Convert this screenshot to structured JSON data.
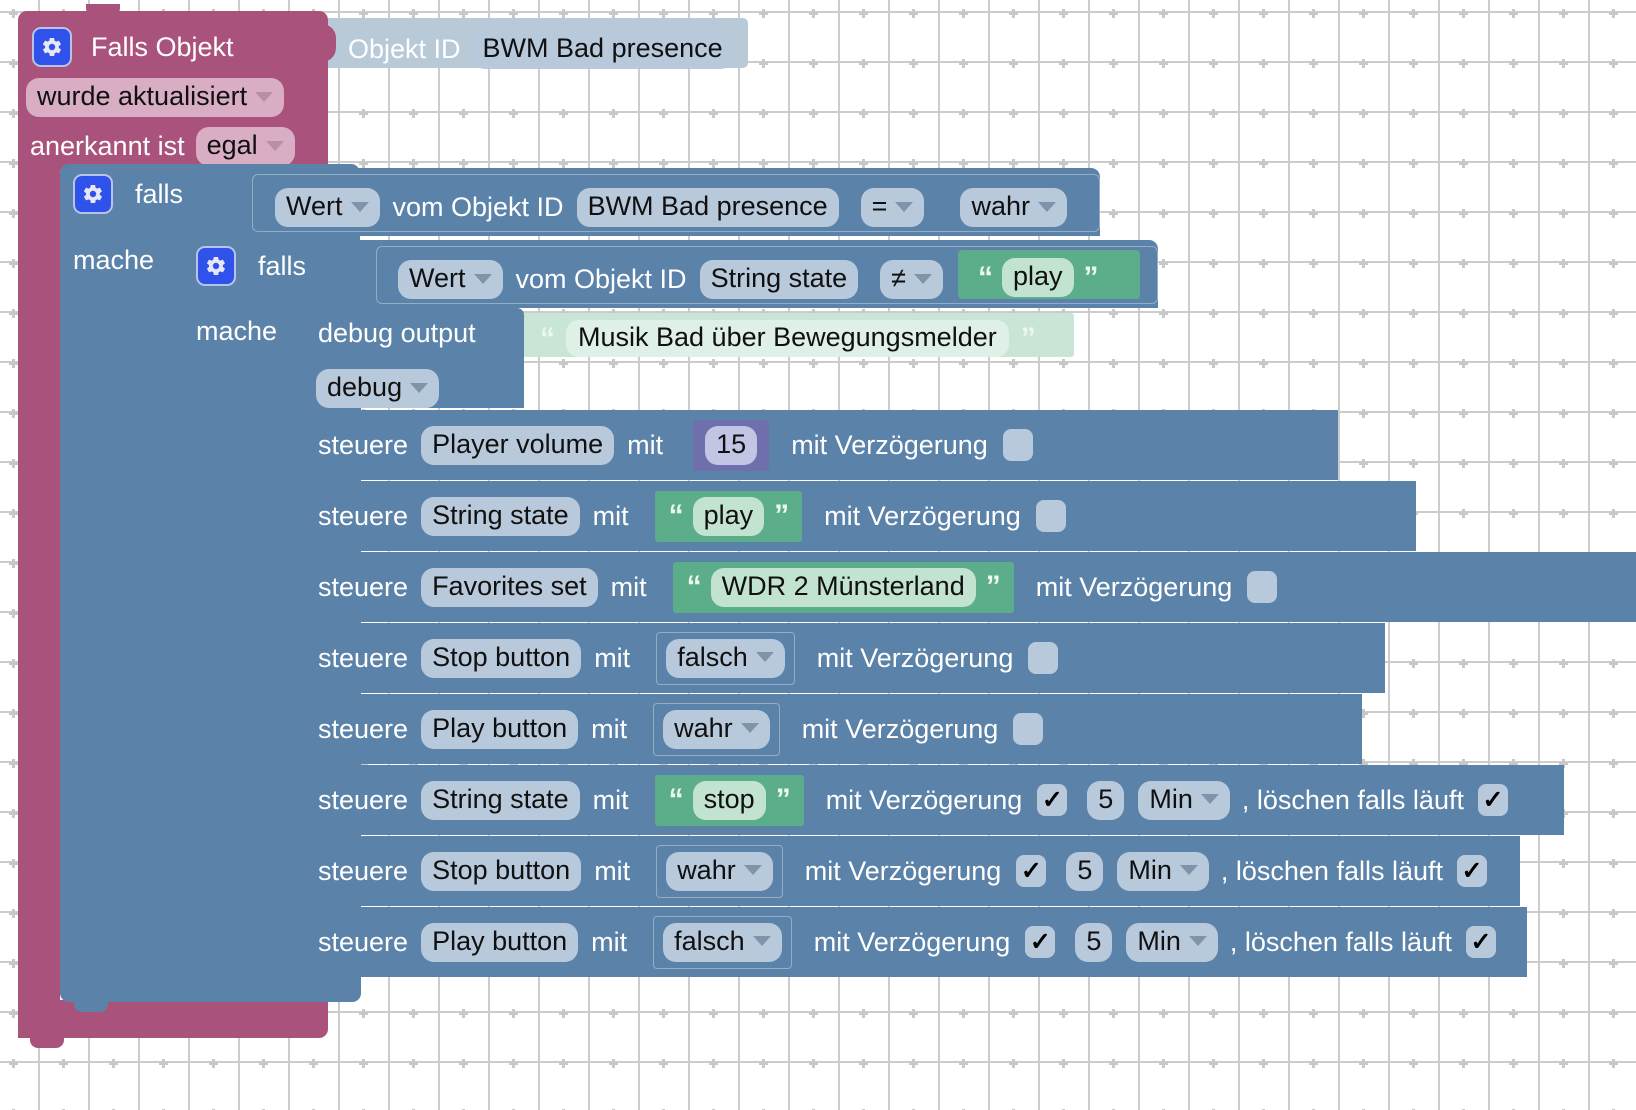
{
  "app": {
    "kind": "blockly-visual-script",
    "language": "de",
    "background": "#ffffff",
    "grid_color": "#c8c8c8",
    "grid_spacing": 50
  },
  "colors": {
    "trigger_block": "#a9537c",
    "trigger_field": "#d9aec4",
    "logic_block": "#5b82a8",
    "logic_field": "#b9c9dc",
    "object_block": "#b8c9d8",
    "string_block": "#5cae8a",
    "string_field": "#c3e3d1",
    "debug_string_block": "#c9e5d5",
    "debug_string_field": "#dff0e6",
    "number_block": "#6f6fae",
    "number_field": "#c2c6e4",
    "gear_icon": "#2f52ea"
  },
  "trigger": {
    "gear_icon": "gear-icon",
    "title": "Falls Objekt",
    "mode": "wurde aktualisiert",
    "ack_label": "anerkannt ist",
    "ack_value": "egal",
    "object": {
      "label": "Objekt ID",
      "value": "BWM Bad presence"
    }
  },
  "if_outer": {
    "gear_icon": "gear-icon",
    "keyword": "falls",
    "do_keyword": "mache",
    "condition": {
      "getter_mode": "Wert",
      "getter_label": "vom Objekt ID",
      "object_id": "BWM Bad presence",
      "operator": "=",
      "compare_value": "wahr"
    }
  },
  "if_inner": {
    "gear_icon": "gear-icon",
    "keyword": "falls",
    "do_keyword": "mache",
    "condition": {
      "getter_mode": "Wert",
      "getter_label": "vom Objekt ID",
      "object_id": "String state",
      "operator": "≠",
      "compare_value": "play"
    }
  },
  "debug": {
    "label": "debug output",
    "message": "Musik Bad über Bewegungsmelder",
    "level": "debug",
    "quote_open": "“",
    "quote_close": "”"
  },
  "control_rows": [
    {
      "keyword": "steuere",
      "target": "Player volume",
      "with_label": "mit",
      "value": "15",
      "value_type": "number",
      "delay_label": "mit Verzögerung",
      "delay_checked": false,
      "delay_amount": "",
      "delay_unit": "",
      "clear_label": "",
      "clear_checked": null
    },
    {
      "keyword": "steuere",
      "target": "String state",
      "with_label": "mit",
      "value": "play",
      "value_type": "string",
      "delay_label": "mit Verzögerung",
      "delay_checked": false,
      "delay_amount": "",
      "delay_unit": "",
      "clear_label": "",
      "clear_checked": null
    },
    {
      "keyword": "steuere",
      "target": "Favorites set",
      "with_label": "mit",
      "value": "WDR 2 Münsterland",
      "value_type": "string",
      "delay_label": "mit Verzögerung",
      "delay_checked": false,
      "delay_amount": "",
      "delay_unit": "",
      "clear_label": "",
      "clear_checked": null
    },
    {
      "keyword": "steuere",
      "target": "Stop button",
      "with_label": "mit",
      "value": "falsch",
      "value_type": "boolean",
      "delay_label": "mit Verzögerung",
      "delay_checked": false,
      "delay_amount": "",
      "delay_unit": "",
      "clear_label": "",
      "clear_checked": null
    },
    {
      "keyword": "steuere",
      "target": "Play button",
      "with_label": "mit",
      "value": "wahr",
      "value_type": "boolean",
      "delay_label": "mit Verzögerung",
      "delay_checked": false,
      "delay_amount": "",
      "delay_unit": "",
      "clear_label": "",
      "clear_checked": null
    },
    {
      "keyword": "steuere",
      "target": "String state",
      "with_label": "mit",
      "value": "stop",
      "value_type": "string",
      "delay_label": "mit Verzögerung",
      "delay_checked": true,
      "delay_amount": "5",
      "delay_unit": "Min",
      "clear_label": ", löschen falls läuft",
      "clear_checked": true
    },
    {
      "keyword": "steuere",
      "target": "Stop button",
      "with_label": "mit",
      "value": "wahr",
      "value_type": "boolean",
      "delay_label": "mit Verzögerung",
      "delay_checked": true,
      "delay_amount": "5",
      "delay_unit": "Min",
      "clear_label": ", löschen falls läuft",
      "clear_checked": true
    },
    {
      "keyword": "steuere",
      "target": "Play button",
      "with_label": "mit",
      "value": "falsch",
      "value_type": "boolean",
      "delay_label": "mit Verzögerung",
      "delay_checked": true,
      "delay_amount": "5",
      "delay_unit": "Min",
      "clear_label": ", löschen falls läuft",
      "clear_checked": true
    }
  ],
  "glyphs": {
    "check": "✓",
    "quote_open": "“",
    "quote_close": "”"
  }
}
